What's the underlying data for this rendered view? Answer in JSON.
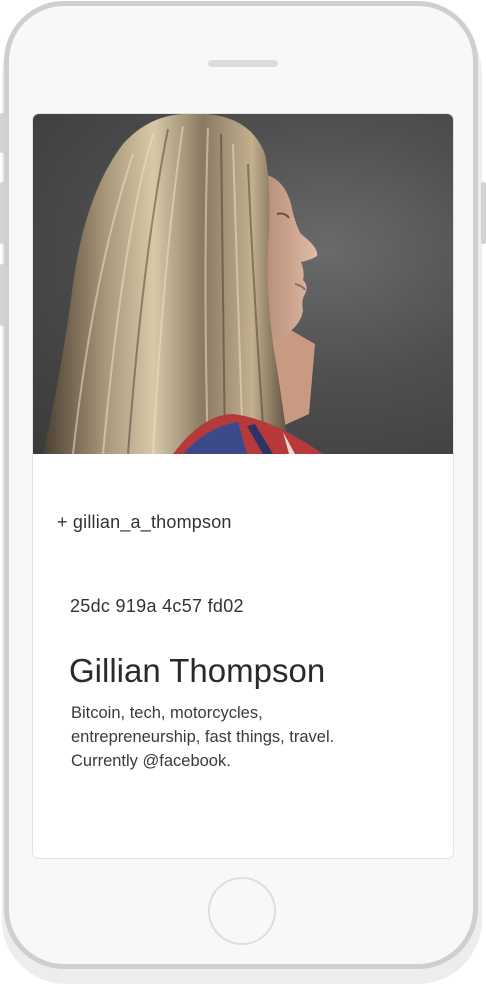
{
  "profile": {
    "handle": "+ gillian_a_thompson",
    "fingerprint": "25dc 919a 4c57 fd02",
    "name": "Gillian Thompson",
    "bio_lines": [
      "Bitcoin, tech, motorcycles,",
      "entrepreneurship, fast things, travel.",
      "Currently @facebook."
    ]
  },
  "colors": {
    "frame": "#cfcfcf",
    "screen_bg": "#f8f8f8",
    "card_bg": "#ffffff",
    "text": "#333333"
  },
  "icons": {
    "photo": "profile-photo",
    "home": "home-button"
  }
}
